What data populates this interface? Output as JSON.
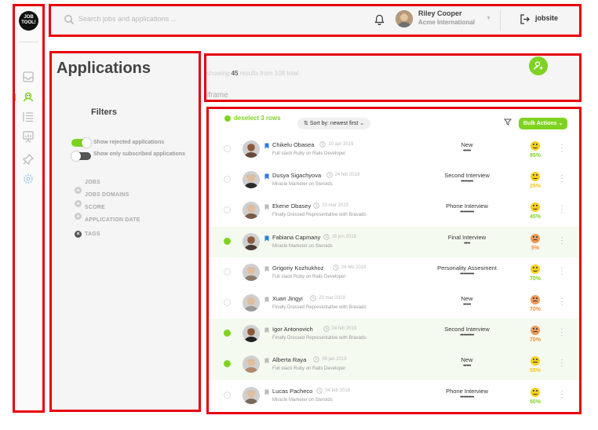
{
  "app": {
    "logo_line1": "JOB",
    "logo_line2": "TOOL!"
  },
  "sidebar": {
    "icons": [
      "inbox-icon",
      "candidates-icon",
      "list-icon",
      "presentation-icon",
      "pin-icon",
      "settings-icon"
    ],
    "active_index": 1,
    "accent": "#7ed321"
  },
  "topbar": {
    "search_placeholder": "Search jobs and applications ...",
    "user_name": "Riley Cooper",
    "user_org": "Acme International",
    "site_link": "jobsite"
  },
  "filters": {
    "page_title": "Applications",
    "title": "Filters",
    "toggles": [
      {
        "label": "Show rejected applications",
        "on": true
      },
      {
        "label": "Show only subscribed applications",
        "on": false
      }
    ],
    "categories": [
      {
        "label": "JOBS",
        "expandable": false
      },
      {
        "label": "JOBS DOMAINS",
        "expandable": true
      },
      {
        "label": "SCORE",
        "expandable": true
      },
      {
        "label": "APPLICATION DATE",
        "expandable": true
      },
      {
        "label": "TAGS",
        "expandable": false,
        "active": true
      }
    ]
  },
  "results": {
    "showing_prefix": "showing",
    "count": "45",
    "showing_middle": "results from",
    "total": "108",
    "showing_suffix": "total",
    "iframe_label": "iframe"
  },
  "table": {
    "deselect_label": "deselect 3 rows",
    "sort_label": "Sort by: newest first",
    "bulk_label": "Bulk Actions",
    "rows": [
      {
        "name": "Chikelu Obasea",
        "date": "10 apr 2019",
        "role": "Full stack Ruby on Rails Developer",
        "stage": "New",
        "dots": "•••••",
        "score": "85%",
        "mood": "happy",
        "selected": false,
        "flagged": true
      },
      {
        "name": "Dusya Sigachyova",
        "date": "24 feb 2019",
        "role": "Miracle Marketer on Steroids",
        "stage": "Second Interview",
        "dots": "••••••••",
        "score": "25%",
        "mood": "happy",
        "selected": false,
        "flagged": true
      },
      {
        "name": "Ekene Obasey",
        "date": "23 mar 2019",
        "role": "Finally Dressed Representative with Bravado",
        "stage": "Phone Interview",
        "dots": "•••••••••",
        "score": "45%",
        "mood": "happy",
        "selected": false,
        "flagged": false
      },
      {
        "name": "Fabiana Capmany",
        "date": "16 jun 2018",
        "role": "Miracle Marketer on Steroids",
        "stage": "Final Interview",
        "dots": "••••",
        "score": "5%",
        "mood": "sad",
        "selected": true,
        "flagged": true
      },
      {
        "name": "Grigoriy Kozhukhoz",
        "date": "24 feb 2019",
        "role": "Full stack Ruby on Rails Developer",
        "stage": "Personality Assesment",
        "dots": "•••••••••",
        "score": "70%",
        "mood": "happy",
        "selected": false,
        "flagged": false
      },
      {
        "name": "Xuan Jingyi",
        "date": "23 mar 2019",
        "role": "Finally Dressed Representative with Bravado",
        "stage": "New",
        "dots": "•••••",
        "score": "70%",
        "mood": "sad",
        "selected": false,
        "flagged": false
      },
      {
        "name": "Igor Antonovich",
        "date": "24 feb 2019",
        "role": "Finally Dressed Representative with Bravado",
        "stage": "Second Interview",
        "dots": "•••••••••",
        "score": "70%",
        "mood": "sad",
        "selected": true,
        "flagged": false
      },
      {
        "name": "Alberta Raya",
        "date": "09 jan 2019",
        "role": "Full stack Ruby on Rails Developer",
        "stage": "New",
        "dots": "•••••",
        "score": "55%",
        "mood": "neutral",
        "selected": true,
        "flagged": false
      },
      {
        "name": "Lucas Pacheco",
        "date": "04 feb 2019",
        "role": "Miracle Marketer on Steroids",
        "stage": "Phone Interview",
        "dots": "•••••••••",
        "score": "50%",
        "mood": "happy",
        "selected": false,
        "flagged": false
      }
    ]
  },
  "colors": {
    "accent": "#7ed321",
    "score_green": "#7ed321",
    "score_yellow": "#f5c518",
    "score_orange": "#f08a3b",
    "face_yellow": "#f7d01c",
    "face_orange": "#f39a5a"
  }
}
